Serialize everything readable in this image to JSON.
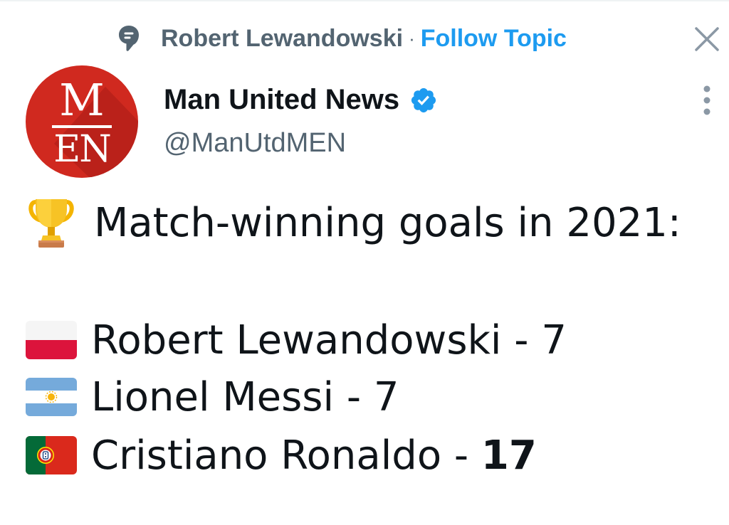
{
  "topic": {
    "name": "Robert Lewandowski",
    "separator": "·",
    "follow_label": "Follow Topic"
  },
  "author": {
    "display_name": "Man United News",
    "handle": "@ManUtdMEN",
    "avatar_letters_top": "M",
    "avatar_letters_bottom": "EN",
    "verified": true
  },
  "tweet": {
    "heading": "Match-winning goals in 2021:",
    "rows": [
      {
        "flag": "poland-flag",
        "name": "Robert Lewandowski",
        "sep": " - ",
        "goals": "7",
        "bold": false
      },
      {
        "flag": "argentina-flag",
        "name": "Lionel Messi",
        "sep": " - ",
        "goals": "7",
        "bold": false
      },
      {
        "flag": "portugal-flag",
        "name": "Cristiano Ronaldo",
        "sep": " - ",
        "goals": "17",
        "bold": true
      }
    ]
  },
  "icons": {
    "topic": "topic-speech-icon",
    "close": "close-icon",
    "verified": "verified-badge-icon",
    "more": "more-vertical-icon",
    "trophy": "trophy-icon"
  },
  "colors": {
    "accent": "#1d9bf0",
    "secondary_text": "#536471",
    "primary_text": "#0f1419",
    "avatar_red": "#d0291f"
  }
}
